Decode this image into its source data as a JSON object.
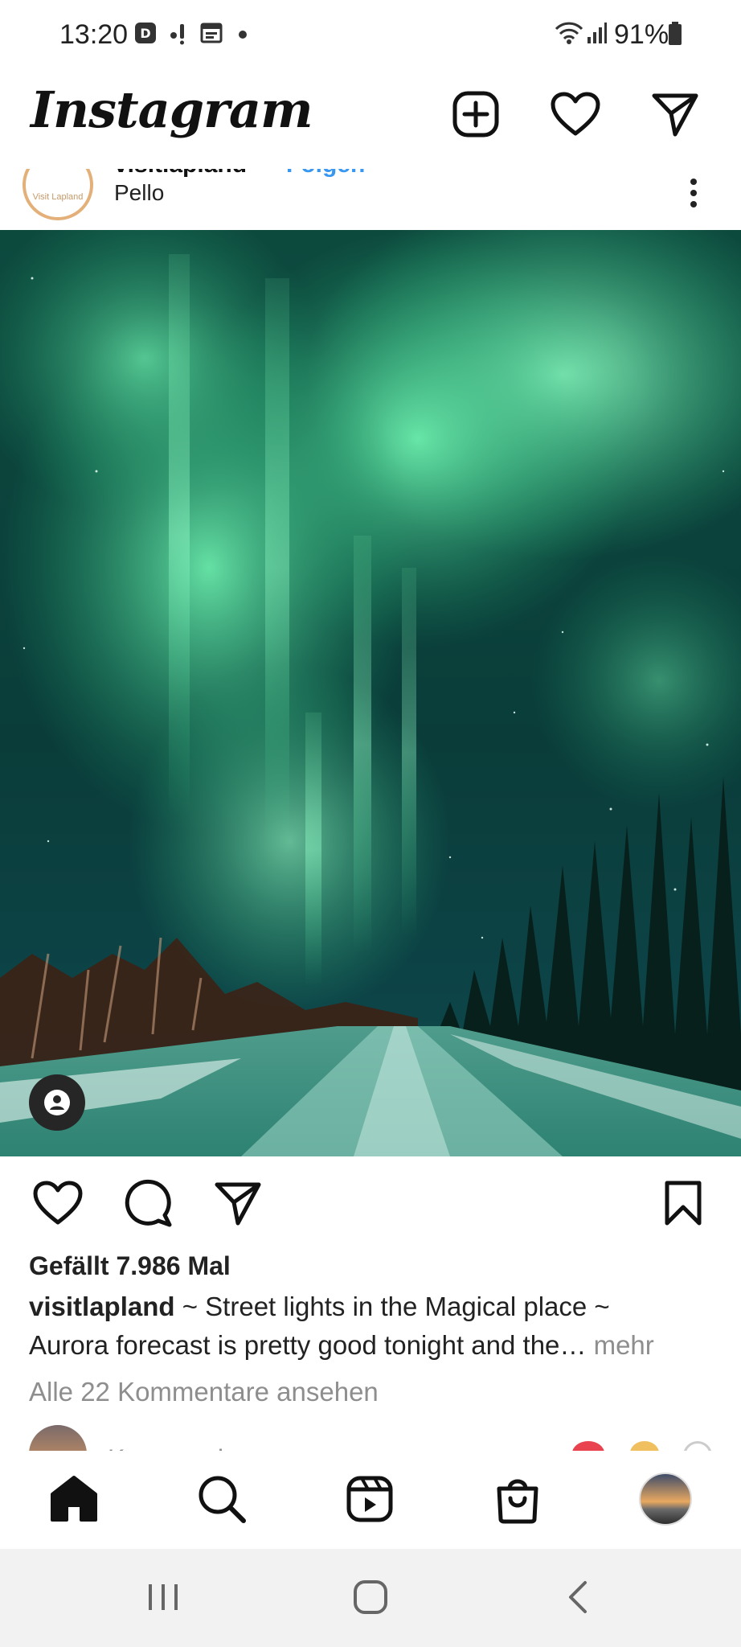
{
  "status_bar": {
    "time": "13:20",
    "battery": "91%",
    "icons": [
      "disney-plus-icon",
      "notification-icon",
      "calendar-icon",
      "dot-icon",
      "wifi-icon",
      "signal-icon",
      "battery-icon"
    ]
  },
  "header": {
    "title": "Instagram",
    "icons": [
      "new-post-icon",
      "heart-icon",
      "direct-message-icon"
    ]
  },
  "post": {
    "username": "visitlapland",
    "follow_label": "Folgen",
    "location": "Pello",
    "avatar_text": "Visit Lapland",
    "likes": "Gefällt 7.986 Mal",
    "caption_user": "visitlapland",
    "caption_line1": " ~ Street lights in the Magical place ~",
    "caption_line2": "Aurora forecast is pretty good tonight and the…",
    "caption_more": " mehr",
    "view_comments": "Alle 22 Kommentare ansehen",
    "comment_peek_text": "Kommentieren"
  },
  "bottom_nav": {
    "items": [
      "home-icon",
      "search-icon",
      "reels-icon",
      "shop-icon",
      "profile-avatar"
    ]
  },
  "system_nav": {
    "items": [
      "recent-apps-icon",
      "home-button-icon",
      "back-icon"
    ]
  },
  "colors": {
    "accent": "#3897f0",
    "aurora": "#5fe0a0",
    "text": "#222222",
    "muted": "#8e8e8e"
  }
}
